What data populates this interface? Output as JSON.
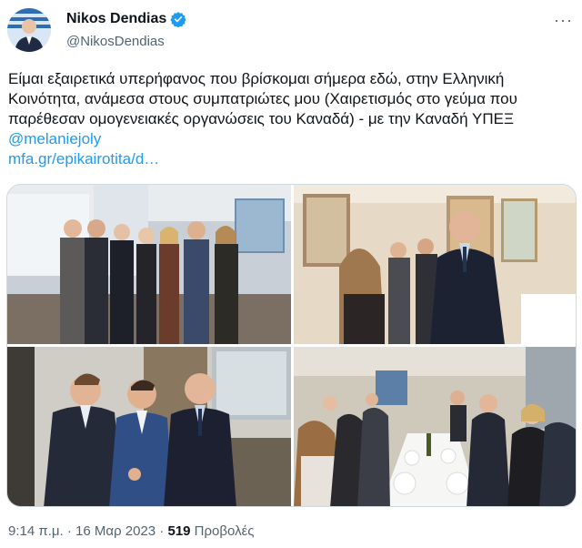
{
  "author": {
    "display_name": "Nikos Dendias",
    "handle": "@NikosDendias",
    "verified": true,
    "avatar_icon": "profile-photo"
  },
  "tweet": {
    "text_before": "Είμαι εξαιρετικά υπερήφανος που βρίσκομαι σήμερα εδώ, στην Ελληνική Κοινότητα, ανάμεσα στους συμπατριώτες μου (Χαιρετισμός στο γεύμα που παρέθεσαν ομογενειακές οργανώσεις του Καναδά) - με την Καναδή ΥΠΕΞ ",
    "mention": "@melaniejoly",
    "link": "mfa.gr/epikairotita/d…"
  },
  "meta": {
    "time": "9:14 π.μ.",
    "separator": " · ",
    "date": "16 Μαρ 2023",
    "views_count": "519",
    "views_label": " Προβολές"
  },
  "colors": {
    "accent": "#1d9bf0",
    "text": "#0f1419",
    "secondary": "#536471",
    "border": "#cfd9de"
  }
}
